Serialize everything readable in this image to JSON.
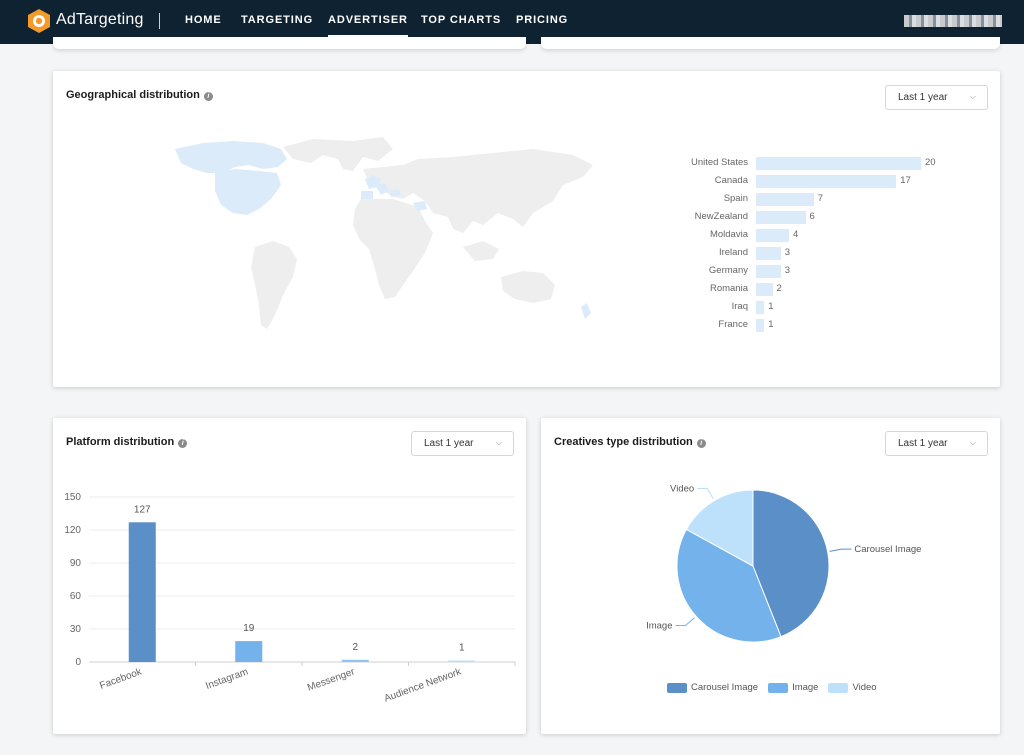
{
  "nav": {
    "brand": "AdTargeting",
    "items": [
      "HOME",
      "TARGETING",
      "ADVERTISER",
      "TOP CHARTS",
      "PRICING"
    ],
    "active": "ADVERTISER"
  },
  "geo": {
    "title": "Geographical distribution",
    "range": "Last 1 year",
    "chart_data": {
      "type": "bar",
      "orientation": "horizontal",
      "categories": [
        "United States",
        "Canada",
        "Spain",
        "NewZealand",
        "Moldavia",
        "Ireland",
        "Germany",
        "Romania",
        "Iraq",
        "France"
      ],
      "values": [
        20,
        17,
        7,
        6,
        4,
        3,
        3,
        2,
        1,
        1
      ],
      "color": "#dcebfa"
    }
  },
  "platform": {
    "title": "Platform distribution",
    "range": "Last 1 year",
    "chart_data": {
      "type": "bar",
      "categories": [
        "Facebook",
        "Instagram",
        "Messenger",
        "Audience Network"
      ],
      "values": [
        127,
        19,
        2,
        1
      ],
      "ylim": [
        0,
        150
      ],
      "yticks": [
        0,
        30,
        60,
        90,
        120,
        150
      ],
      "colors": [
        "#5a8fc8",
        "#73b2ea",
        "#8fc7f2",
        "#bde1fb"
      ],
      "grid": true
    }
  },
  "creative": {
    "title": "Creatives type distribution",
    "range": "Last 1 year",
    "chart_data": {
      "type": "pie",
      "labels": [
        "Carousel Image",
        "Image",
        "Video"
      ],
      "values": [
        44,
        39,
        17
      ],
      "colors": [
        "#5a8fc8",
        "#73b2ea",
        "#bde1fb"
      ],
      "legend": "bottom"
    }
  }
}
